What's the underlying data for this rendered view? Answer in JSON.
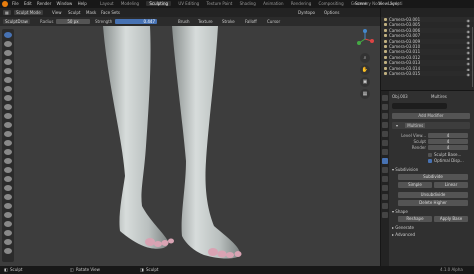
{
  "topbar": {
    "menus": [
      "File",
      "Edit",
      "Render",
      "Window",
      "Help"
    ],
    "workspaces": [
      "Layout",
      "Modeling",
      "Sculpting",
      "UV Editing",
      "Texture Paint",
      "Shading",
      "Animation",
      "Rendering",
      "Compositing",
      "Geometry Node",
      "Scripti"
    ],
    "active_workspace": "Sculpting",
    "scene_label": "Scene",
    "view_layer_label": "ViewLayer"
  },
  "header": {
    "mode": "Sculpt Mode",
    "menus": [
      "View",
      "Sculpt",
      "Mask",
      "Face Sets"
    ],
    "options": [
      "Dyntopo",
      "Options"
    ]
  },
  "toolbar": {
    "brush": "SculptDraw",
    "radius_label": "Radius",
    "radius_value": "50 px",
    "strength_label": "Strength",
    "strength_value": "0.447",
    "dropdowns": [
      "Brush",
      "Texture",
      "Stroke",
      "Falloff",
      "Cursor"
    ]
  },
  "outliner": {
    "items": [
      "Camera-03.001",
      "Camera-03.005",
      "Camera-03.006",
      "Camera-03.007",
      "Camera-03.009",
      "Camera-03.010",
      "Camera-03.011",
      "Camera-03.012",
      "Camera-03.013",
      "Camera-03.014",
      "Camera-03.015"
    ]
  },
  "properties": {
    "object_name": "Obj.003",
    "modifier_chip": "Multires",
    "add_modifier": "Add Modifier",
    "modifier_name": "Multires",
    "level_viewport_label": "Level View...",
    "level_viewport_value": "4",
    "sculpt_label": "Sculpt",
    "sculpt_value": "4",
    "render_label": "Render",
    "render_value": "4",
    "sculpt_base_label": "Sculpt Base...",
    "optimal_display_label": "Optimal Disp...",
    "subdivision_section": "Subdivision",
    "subdivide_btn": "Subdivide",
    "simple_btn": "Simple",
    "linear_btn": "Linear",
    "unsubdivide_btn": "Unsubdivide",
    "delete_higher_btn": "Delete Higher",
    "shape_section": "Shape",
    "reshape_btn": "Reshape",
    "apply_base_btn": "Apply Base",
    "generate_section": "Generate",
    "advanced_section": "Advanced"
  },
  "status": {
    "select": "Sculpt",
    "rotate": "Rotate View",
    "context": "Sculpt",
    "version": "4.1.0 Alpha"
  },
  "colors": {
    "accent": "#4772b3",
    "viewport_bg": "#3d3d3d",
    "panel_bg": "#303030"
  }
}
